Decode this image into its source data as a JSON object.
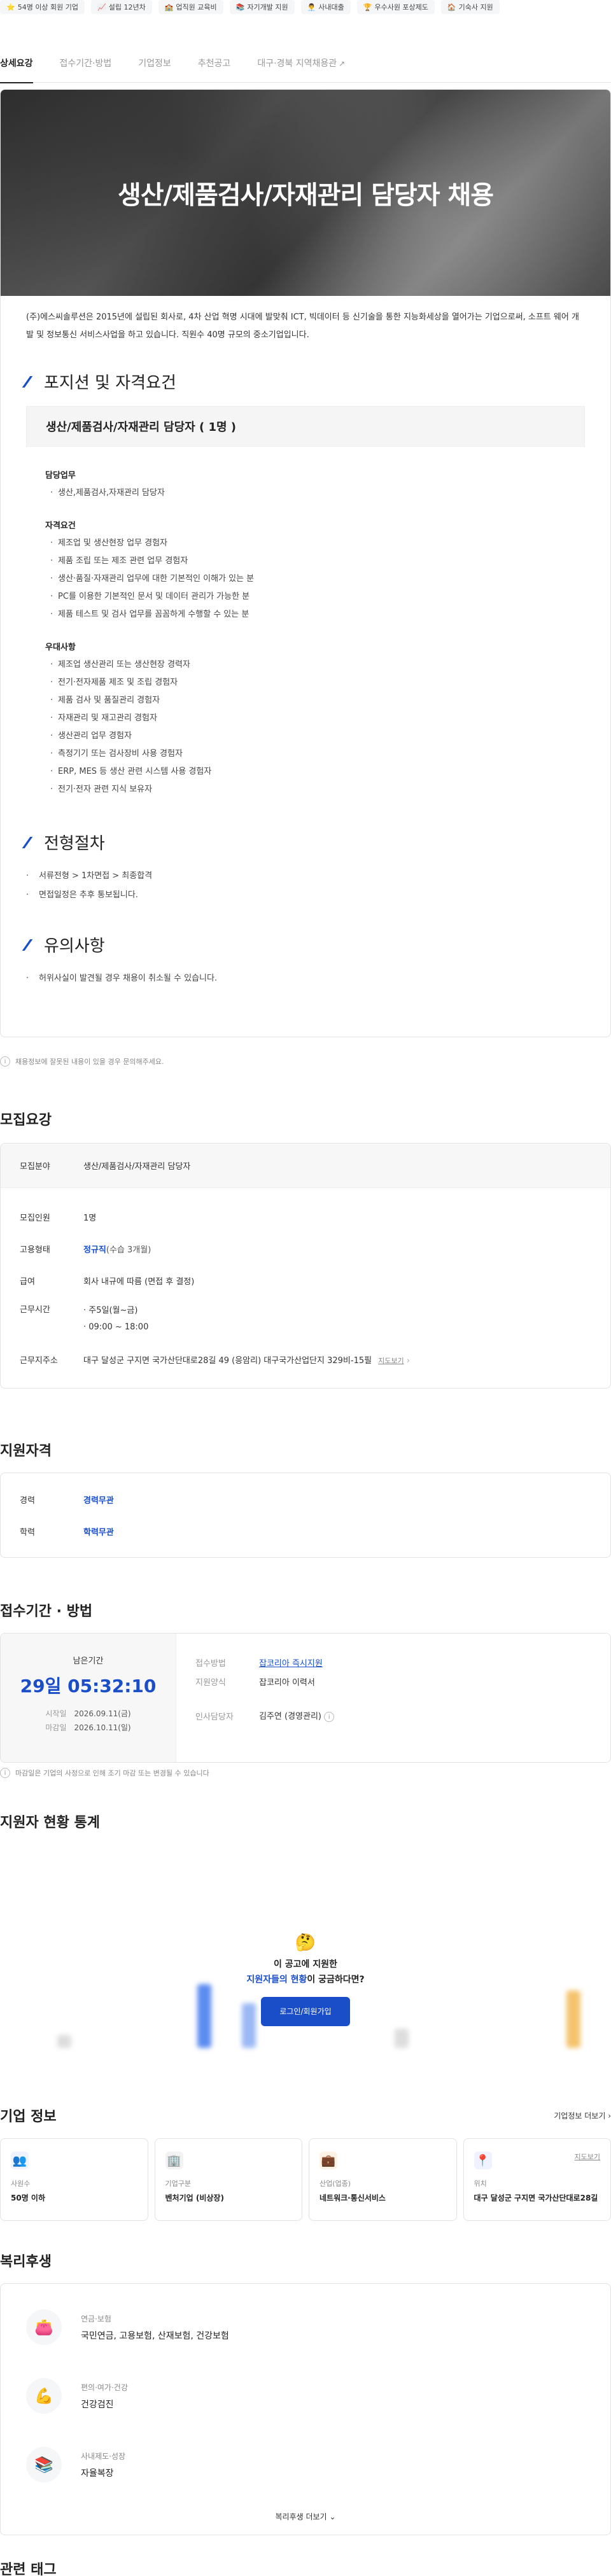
{
  "chips": [
    {
      "icon": "⭐",
      "label": "54명 이상 회원 기업"
    },
    {
      "icon": "📈",
      "label": "설립 12년차"
    },
    {
      "icon": "🏫",
      "label": "업직원 교육비"
    },
    {
      "icon": "📚",
      "label": "자기개발 지원"
    },
    {
      "icon": "👨‍💼",
      "label": "사내대출"
    },
    {
      "icon": "🏆",
      "label": "우수사원 포상제도"
    },
    {
      "icon": "🏠",
      "label": "기숙사 지원"
    }
  ],
  "tabs": [
    "상세요강",
    "접수기간·방법",
    "기업정보",
    "추천공고",
    "대구·경북 지역채용관"
  ],
  "hero_title": "생산/제품검사/자재관리 담당자 채용",
  "intro": "(주)에스씨솔루션은 2015년에 설립된 회사로, 4차 산업 혁명 시대에 발맞춰 ICT, 빅데이터 등 신기술을 통한 지능화세상을 열어가는 기업으로써, 소프트 웨어 개발 및 정보통신 서비스사업을 하고 있습니다. 직원수 40명 규모의 중소기업입니다.",
  "position": {
    "section": "포지션 및 자격요건",
    "title": "생산/제품검사/자재관리 담당자 ( 1명 )",
    "duty_label": "담당업무",
    "duties": [
      "생산,제품검사,자재관리 담당자"
    ],
    "req_label": "자격요건",
    "reqs": [
      "제조업 및 생산현장 업무 경험자",
      "제품 조립 또는 제조 관련 업무 경험자",
      "생산·품질·자재관리 업무에 대한 기본적인 이해가 있는 분",
      "PC를 이용한 기본적인 문서 및 데이터 관리가 가능한 분",
      "제품 테스트 및 검사 업무를 꼼꼼하게 수행할 수 있는 분"
    ],
    "pref_label": "우대사항",
    "prefs": [
      "제조업 생산관리 또는 생산현장 경력자",
      "전기·전자제품 제조 및 조립 경험자",
      "제품 검사 및 품질관리 경험자",
      "자재관리 및 재고관리 경험자",
      "생산관리 업무 경험자",
      "측정기기 또는 검사장비 사용 경험자",
      "ERP, MES 등 생산 관련 시스템 사용 경험자",
      "전기·전자 관련 지식 보유자"
    ]
  },
  "process": {
    "section": "전형절차",
    "items": [
      "서류전형 > 1차면접 > 최종합격",
      "면접일정은 추후 통보됩니다."
    ]
  },
  "caution": {
    "section": "유의사항",
    "items": [
      "허위사실이 발견될 경우 채용이 취소될 수 있습니다."
    ]
  },
  "report_notice": "채용정보에 잘못된 내용이 있을 경우 문의해주세요.",
  "summary": {
    "title": "모집요강",
    "field_k": "모집분야",
    "field_v": "생산/제품검사/자재관리 담당자",
    "count_k": "모집인원",
    "count_v": "1명",
    "type_k": "고용형태",
    "type_v": "정규직",
    "type_note": "(수습 3개월)",
    "pay_k": "급여",
    "pay_v": "회사 내규에 따름 (면접 후 결정)",
    "hours_k": "근무시간",
    "hours_v1": "주5일(월~금)",
    "hours_v2": "09:00 ~ 18:00",
    "addr_k": "근무지주소",
    "addr_v": "대구 달성군 구지면 국가산단대로28길 49 (응암리) 대구국가산업단지 329비-15필",
    "map_link": "지도보기"
  },
  "qual": {
    "title": "지원자격",
    "career_k": "경력",
    "career_v": "경력무관",
    "edu_k": "학력",
    "edu_v": "학력무관"
  },
  "period": {
    "title": "접수기간 · 방법",
    "remain_label": "남은기간",
    "remain": "29일 05:32:10",
    "start_k": "시작일",
    "start_v": "2026.09.11(금)",
    "end_k": "마감일",
    "end_v": "2026.10.11(일)",
    "method_k": "접수방법",
    "method_v": "잡코리아 즉시지원",
    "form_k": "지원양식",
    "form_v": "잡코리아 이력서",
    "hr_k": "인사담당자",
    "hr_v": "김주연 (경영관리)",
    "notice": "마감일은 기업의 사정으로 인해 조기 마감 또는 변경될 수 있습니다"
  },
  "stats": {
    "title": "지원자 현황 통계",
    "line1": "이 공고에 지원한",
    "line2_blue": "지원자들의 현황",
    "line2_rest": "이 궁금하다면?",
    "btn": "로그인/회원가입"
  },
  "company": {
    "title": "기업 정보",
    "more": "기업정보 더보기",
    "map": "지도보기",
    "cards": [
      {
        "icon": "👥",
        "k": "사원수",
        "v": "50명 이하",
        "bg": "#eef3ff"
      },
      {
        "icon": "🏢",
        "k": "기업구분",
        "v": "벤처기업 (비상장)",
        "bg": "#f3f3f3"
      },
      {
        "icon": "💼",
        "k": "산업(업종)",
        "v": "네트워크·통신서비스",
        "bg": "#fff3e6"
      },
      {
        "icon": "📍",
        "k": "위치",
        "v": "대구 달성군 구지면 국가산단대로28길",
        "bg": "#eef3ff"
      }
    ]
  },
  "welfare": {
    "title": "복리후생",
    "items": [
      {
        "icon": "👛",
        "k": "연금·보험",
        "v": "국민연금, 고용보험, 산재보험, 건강보험"
      },
      {
        "icon": "💪",
        "k": "편의·여가·건강",
        "v": "건강검진"
      },
      {
        "icon": "📚",
        "k": "사내제도·성장",
        "v": "자율복장"
      }
    ],
    "more": "복리후생 더보기"
  },
  "tags_title": "관련 태그"
}
